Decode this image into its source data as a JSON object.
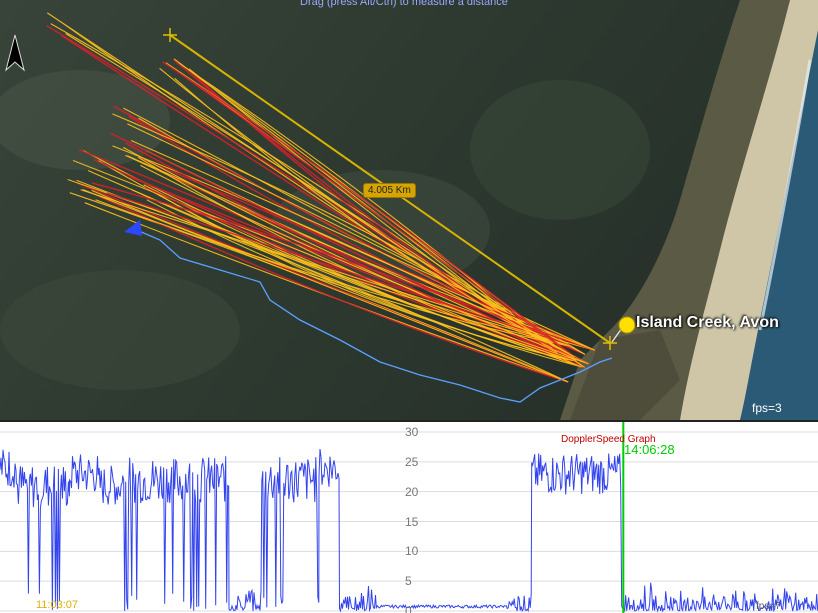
{
  "map": {
    "hint_text": "Drag (press Alt/Ctrl) to measure a distance",
    "place_label": "Island Creek, Avon",
    "distance_label": "4.005 Km",
    "fps_label": "fps=3",
    "compass_icon": "north-arrow-icon",
    "pin_icon": "pushpin-icon",
    "colors": {
      "track_red": "#d8202a",
      "track_yellow": "#ffc21a",
      "track_blue": "#5aa0ff",
      "measure_line": "#d6b400"
    }
  },
  "graph": {
    "title": "DopplerSpeed Graph",
    "cursor_time": "14:06:28",
    "start_time": "11:03:07",
    "fps_label": "fps=7",
    "y_ticks": [
      "0",
      "5",
      "10",
      "15",
      "20",
      "25",
      "30"
    ],
    "colors": {
      "line": "#3344ee",
      "cursor": "#00cc00"
    },
    "chart_data": {
      "type": "line",
      "ylim": [
        0,
        30
      ],
      "grid": true,
      "segments": [
        {
          "x": [
            0,
            0.02
          ],
          "level": 24,
          "state": "high"
        },
        {
          "x": [
            0.02,
            0.085
          ],
          "level": 21,
          "state": "high-gaps"
        },
        {
          "x": [
            0.085,
            0.12
          ],
          "level": 23,
          "state": "high"
        },
        {
          "x": [
            0.12,
            0.15
          ],
          "level": 21,
          "state": "high"
        },
        {
          "x": [
            0.15,
            0.28
          ],
          "level": 22,
          "state": "high-gaps"
        },
        {
          "x": [
            0.28,
            0.32
          ],
          "level": 2,
          "state": "low"
        },
        {
          "x": [
            0.32,
            0.39
          ],
          "level": 22,
          "state": "high-gaps"
        },
        {
          "x": [
            0.39,
            0.415
          ],
          "level": 24,
          "state": "high"
        },
        {
          "x": [
            0.415,
            0.46
          ],
          "level": 1,
          "state": "low"
        },
        {
          "x": [
            0.46,
            0.62
          ],
          "level": 0.5,
          "state": "idle"
        },
        {
          "x": [
            0.62,
            0.65
          ],
          "level": 2,
          "state": "low"
        },
        {
          "x": [
            0.65,
            0.76
          ],
          "level": 23,
          "state": "high"
        },
        {
          "x": [
            0.76,
            1.0
          ],
          "level": 2,
          "state": "low"
        }
      ],
      "cursor_x": 0.762
    }
  }
}
